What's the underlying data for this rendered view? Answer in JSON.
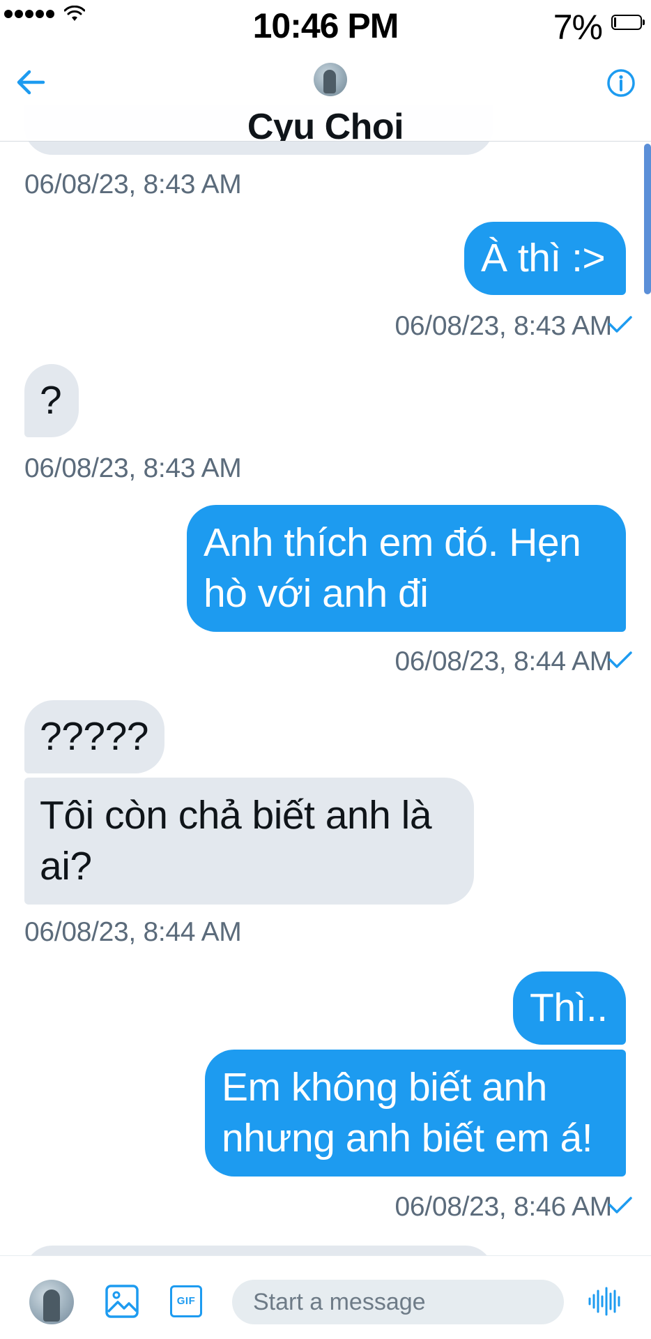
{
  "status_bar": {
    "time": "10:46 PM",
    "battery_percent": "7%",
    "battery_level": 0.07
  },
  "header": {
    "contact_name": "Cyu Choi",
    "back_icon": "arrow-left-icon",
    "info_icon": "info-icon"
  },
  "messages": [
    {
      "direction": "in",
      "text": "",
      "partial": true
    },
    {
      "kind": "timestamp",
      "direction": "in",
      "text": "06/08/23, 8:43 AM"
    },
    {
      "direction": "out",
      "text": "À thì :>"
    },
    {
      "kind": "timestamp",
      "direction": "out",
      "text": "06/08/23, 8:43 AM",
      "status": "sent-check"
    },
    {
      "direction": "in",
      "text": "?"
    },
    {
      "kind": "timestamp",
      "direction": "in",
      "text": "06/08/23, 8:43 AM"
    },
    {
      "direction": "out",
      "lines": [
        "Anh thích em đó. Hẹn",
        "hò với anh đi"
      ]
    },
    {
      "kind": "timestamp",
      "direction": "out",
      "text": "06/08/23, 8:44 AM",
      "status": "sent-check"
    },
    {
      "direction": "in",
      "text": "?????"
    },
    {
      "direction": "in",
      "lines": [
        "Tôi còn chả biết anh là",
        "ai?"
      ]
    },
    {
      "kind": "timestamp",
      "direction": "in",
      "text": "06/08/23, 8:44 AM"
    },
    {
      "direction": "out",
      "text": "Thì.."
    },
    {
      "direction": "out",
      "lines": [
        "Em không biết anh",
        "nhưng anh biết em á!"
      ]
    },
    {
      "kind": "timestamp",
      "direction": "out",
      "text": "06/08/23, 8:46 AM",
      "status": "sent-check"
    },
    {
      "direction": "in",
      "text": "",
      "partial": true
    }
  ],
  "composer": {
    "placeholder": "Start a message",
    "icons": [
      "avatar",
      "image-icon",
      "gif-icon",
      "voice-wave-icon"
    ],
    "gif_label": "GIF"
  },
  "colors": {
    "accent": "#1d9bf0",
    "incoming_bubble": "#e3e8ee",
    "timestamp": "#5b6b7b"
  }
}
